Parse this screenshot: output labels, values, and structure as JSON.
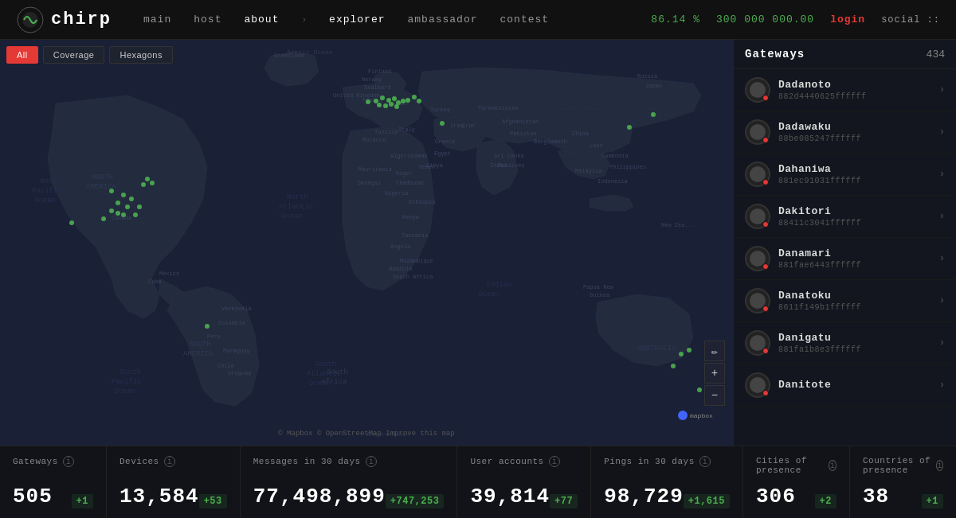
{
  "header": {
    "logo_text": "chirp",
    "nav": {
      "main": "main",
      "host": "host",
      "about": "about",
      "arrow": "›",
      "explorer": "explorer",
      "ambassador": "ambassador",
      "contest": "contest",
      "login": "login",
      "social": "social",
      "separator": "::"
    },
    "counter": "300 000 000.00",
    "percent": "86.14 %"
  },
  "map": {
    "controls": [
      "All",
      "Coverage",
      "Hexagons"
    ],
    "active_control": "All",
    "attribution": "© Mapbox  © OpenStreetMap  Improve this map"
  },
  "sidebar": {
    "title": "Gateways",
    "count": "434",
    "items": [
      {
        "name": "Dadanoto",
        "id": "882d4440625ffffff"
      },
      {
        "name": "Dadawaku",
        "id": "88be085247ffffff"
      },
      {
        "name": "Dahaniwa",
        "id": "881ec91031ffffff"
      },
      {
        "name": "Dakitori",
        "id": "88411c3041ffffff"
      },
      {
        "name": "Danamari",
        "id": "881fae6443ffffff"
      },
      {
        "name": "Danatoku",
        "id": "8611f149b1ffffff"
      },
      {
        "name": "Danigatu",
        "id": "881fa1b8e3ffffff"
      },
      {
        "name": "Danitote",
        "id": ""
      }
    ]
  },
  "stats": [
    {
      "label": "Gateways",
      "value": "505",
      "delta": "+1",
      "positive": true
    },
    {
      "label": "Devices",
      "value": "13,584",
      "delta": "+53",
      "positive": true
    },
    {
      "label": "Messages in 30 days",
      "value": "77,498,899",
      "delta": "+747,253",
      "positive": true
    },
    {
      "label": "User accounts",
      "value": "39,814",
      "delta": "+77",
      "positive": true
    },
    {
      "label": "Pings in 30 days",
      "value": "98,729",
      "delta": "+1,615",
      "positive": true
    },
    {
      "label": "Cities of presence",
      "value": "306",
      "delta": "+2",
      "positive": true
    },
    {
      "label": "Countries of presence",
      "value": "38",
      "delta": "+1",
      "positive": true
    }
  ]
}
